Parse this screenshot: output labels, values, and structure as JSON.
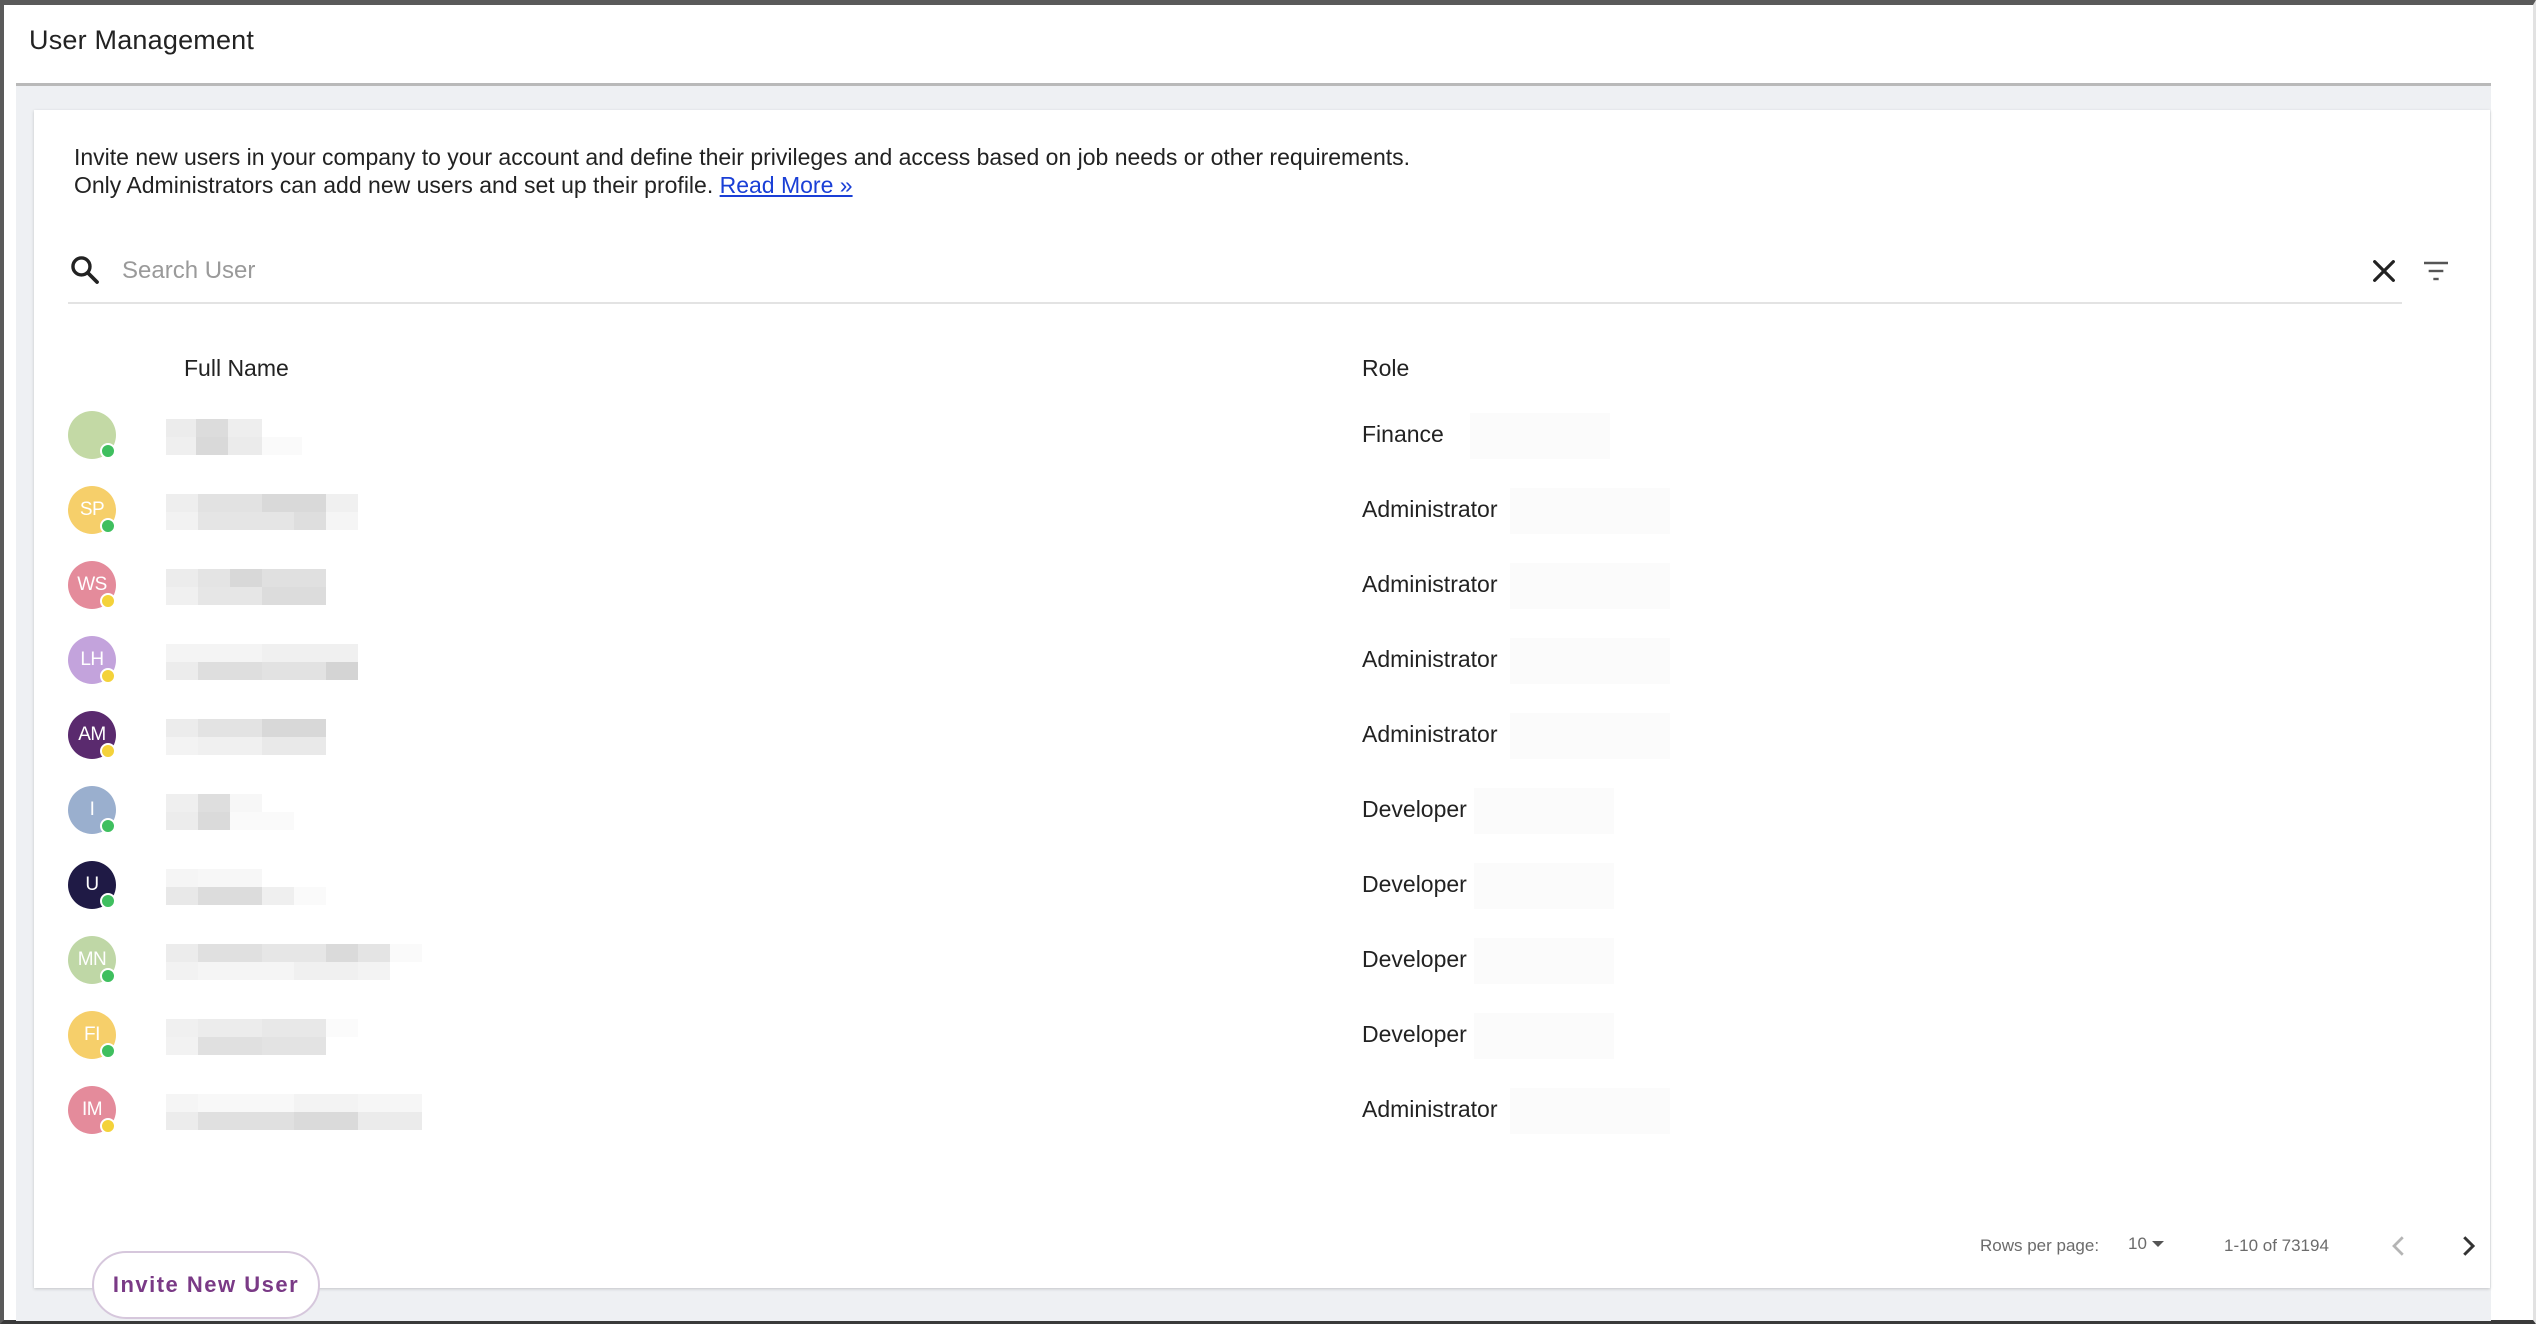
{
  "header": {
    "title": "User Management"
  },
  "intro": {
    "line1": "Invite new users in your company to your account and define their privileges and access based on job needs or other requirements.",
    "line2": "Only Administrators can add new users and set up their profile.",
    "read_more": "Read More »"
  },
  "search": {
    "placeholder": "Search User",
    "icon": "search-icon",
    "clear_icon": "close-icon",
    "filter_icon": "filter-icon"
  },
  "table": {
    "columns": {
      "name": "Full Name",
      "role": "Role"
    },
    "rows": [
      {
        "initials": "",
        "avatar_color": "#c3d9a5",
        "status_color": "#3fbf5f",
        "name_redacted": true,
        "role": "Finance"
      },
      {
        "initials": "SP",
        "avatar_color": "#f6cf6a",
        "status_color": "#3fbf5f",
        "name_redacted": true,
        "role": "Administrator"
      },
      {
        "initials": "WS",
        "avatar_color": "#e48b9b",
        "status_color": "#f4d23a",
        "name_redacted": true,
        "role": "Administrator"
      },
      {
        "initials": "LH",
        "avatar_color": "#c3a3dc",
        "status_color": "#f4d23a",
        "name_redacted": true,
        "role": "Administrator"
      },
      {
        "initials": "AM",
        "avatar_color": "#5a2a6e",
        "status_color": "#f4d23a",
        "name_redacted": true,
        "role": "Administrator"
      },
      {
        "initials": "I",
        "avatar_color": "#9aafce",
        "status_color": "#3fbf5f",
        "name_redacted": true,
        "role": "Developer"
      },
      {
        "initials": "U",
        "avatar_color": "#1f1a45",
        "status_color": "#3fbf5f",
        "name_redacted": true,
        "role": "Developer"
      },
      {
        "initials": "MN",
        "avatar_color": "#bfd7a6",
        "status_color": "#3fbf5f",
        "name_redacted": true,
        "role": "Developer"
      },
      {
        "initials": "FI",
        "avatar_color": "#f6cf6a",
        "status_color": "#3fbf5f",
        "name_redacted": true,
        "role": "Developer"
      },
      {
        "initials": "IM",
        "avatar_color": "#e48b9b",
        "status_color": "#f4d23a",
        "name_redacted": true,
        "role": "Administrator"
      }
    ]
  },
  "pagination": {
    "rows_per_page_label": "Rows per page:",
    "rows_per_page_value": "10",
    "range": "1-10 of 73194"
  },
  "actions": {
    "invite_label": "Invite New User"
  },
  "colors": {
    "link": "#1a3fd6",
    "invite_text": "#7a3a86",
    "online": "#3fbf5f",
    "away": "#f4d23a"
  }
}
